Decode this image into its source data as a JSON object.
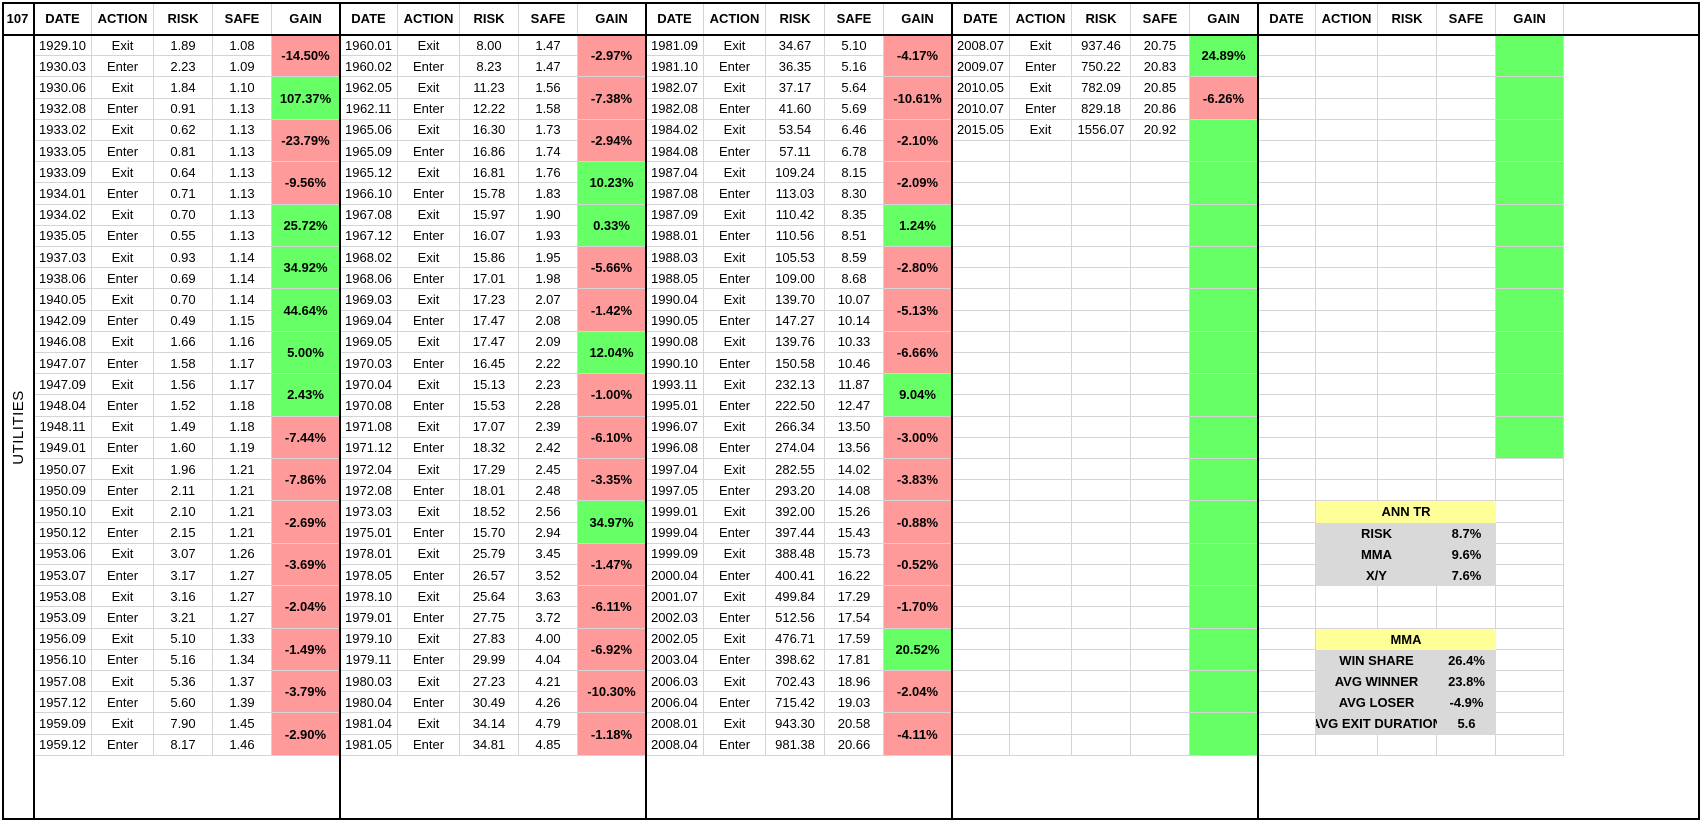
{
  "corner_label": "107",
  "side_label": "UTILITIES",
  "headers": [
    "DATE",
    "ACTION",
    "RISK",
    "SAFE",
    "GAIN"
  ],
  "colors": {
    "loss": "#ff9a9a",
    "win": "#66ff66",
    "stat_title": "#ffff99",
    "stat_row": "#d9d9d9"
  },
  "blocks": [
    {
      "rows": [
        [
          "1929.10",
          "Exit",
          "1.89",
          "1.08"
        ],
        [
          "1930.03",
          "Enter",
          "2.23",
          "1.09"
        ],
        [
          "1930.06",
          "Exit",
          "1.84",
          "1.10"
        ],
        [
          "1932.08",
          "Enter",
          "0.91",
          "1.13"
        ],
        [
          "1933.02",
          "Exit",
          "0.62",
          "1.13"
        ],
        [
          "1933.05",
          "Enter",
          "0.81",
          "1.13"
        ],
        [
          "1933.09",
          "Exit",
          "0.64",
          "1.13"
        ],
        [
          "1934.01",
          "Enter",
          "0.71",
          "1.13"
        ],
        [
          "1934.02",
          "Exit",
          "0.70",
          "1.13"
        ],
        [
          "1935.05",
          "Enter",
          "0.55",
          "1.13"
        ],
        [
          "1937.03",
          "Exit",
          "0.93",
          "1.14"
        ],
        [
          "1938.06",
          "Enter",
          "0.69",
          "1.14"
        ],
        [
          "1940.05",
          "Exit",
          "0.70",
          "1.14"
        ],
        [
          "1942.09",
          "Enter",
          "0.49",
          "1.15"
        ],
        [
          "1946.08",
          "Exit",
          "1.66",
          "1.16"
        ],
        [
          "1947.07",
          "Enter",
          "1.58",
          "1.17"
        ],
        [
          "1947.09",
          "Exit",
          "1.56",
          "1.17"
        ],
        [
          "1948.04",
          "Enter",
          "1.52",
          "1.18"
        ],
        [
          "1948.11",
          "Exit",
          "1.49",
          "1.18"
        ],
        [
          "1949.01",
          "Enter",
          "1.60",
          "1.19"
        ],
        [
          "1950.07",
          "Exit",
          "1.96",
          "1.21"
        ],
        [
          "1950.09",
          "Enter",
          "2.11",
          "1.21"
        ],
        [
          "1950.10",
          "Exit",
          "2.10",
          "1.21"
        ],
        [
          "1950.12",
          "Enter",
          "2.15",
          "1.21"
        ],
        [
          "1953.06",
          "Exit",
          "3.07",
          "1.26"
        ],
        [
          "1953.07",
          "Enter",
          "3.17",
          "1.27"
        ],
        [
          "1953.08",
          "Exit",
          "3.16",
          "1.27"
        ],
        [
          "1953.09",
          "Enter",
          "3.21",
          "1.27"
        ],
        [
          "1956.09",
          "Exit",
          "5.10",
          "1.33"
        ],
        [
          "1956.10",
          "Enter",
          "5.16",
          "1.34"
        ],
        [
          "1957.08",
          "Exit",
          "5.36",
          "1.37"
        ],
        [
          "1957.12",
          "Enter",
          "5.60",
          "1.39"
        ],
        [
          "1959.09",
          "Exit",
          "7.90",
          "1.45"
        ],
        [
          "1959.12",
          "Enter",
          "8.17",
          "1.46"
        ]
      ],
      "gains": [
        {
          "v": "-14.50%",
          "c": "loss"
        },
        {
          "v": "107.37%",
          "c": "win"
        },
        {
          "v": "-23.79%",
          "c": "loss"
        },
        {
          "v": "-9.56%",
          "c": "loss"
        },
        {
          "v": "25.72%",
          "c": "win"
        },
        {
          "v": "34.92%",
          "c": "win"
        },
        {
          "v": "44.64%",
          "c": "win"
        },
        {
          "v": "5.00%",
          "c": "win"
        },
        {
          "v": "2.43%",
          "c": "win"
        },
        {
          "v": "-7.44%",
          "c": "loss"
        },
        {
          "v": "-7.86%",
          "c": "loss"
        },
        {
          "v": "-2.69%",
          "c": "loss"
        },
        {
          "v": "-3.69%",
          "c": "loss"
        },
        {
          "v": "-2.04%",
          "c": "loss"
        },
        {
          "v": "-1.49%",
          "c": "loss"
        },
        {
          "v": "-3.79%",
          "c": "loss"
        },
        {
          "v": "-2.90%",
          "c": "loss"
        }
      ]
    },
    {
      "rows": [
        [
          "1960.01",
          "Exit",
          "8.00",
          "1.47"
        ],
        [
          "1960.02",
          "Enter",
          "8.23",
          "1.47"
        ],
        [
          "1962.05",
          "Exit",
          "11.23",
          "1.56"
        ],
        [
          "1962.11",
          "Enter",
          "12.22",
          "1.58"
        ],
        [
          "1965.06",
          "Exit",
          "16.30",
          "1.73"
        ],
        [
          "1965.09",
          "Enter",
          "16.86",
          "1.74"
        ],
        [
          "1965.12",
          "Exit",
          "16.81",
          "1.76"
        ],
        [
          "1966.10",
          "Enter",
          "15.78",
          "1.83"
        ],
        [
          "1967.08",
          "Exit",
          "15.97",
          "1.90"
        ],
        [
          "1967.12",
          "Enter",
          "16.07",
          "1.93"
        ],
        [
          "1968.02",
          "Exit",
          "15.86",
          "1.95"
        ],
        [
          "1968.06",
          "Enter",
          "17.01",
          "1.98"
        ],
        [
          "1969.03",
          "Exit",
          "17.23",
          "2.07"
        ],
        [
          "1969.04",
          "Enter",
          "17.47",
          "2.08"
        ],
        [
          "1969.05",
          "Exit",
          "17.47",
          "2.09"
        ],
        [
          "1970.03",
          "Enter",
          "16.45",
          "2.22"
        ],
        [
          "1970.04",
          "Exit",
          "15.13",
          "2.23"
        ],
        [
          "1970.08",
          "Enter",
          "15.53",
          "2.28"
        ],
        [
          "1971.08",
          "Exit",
          "17.07",
          "2.39"
        ],
        [
          "1971.12",
          "Enter",
          "18.32",
          "2.42"
        ],
        [
          "1972.04",
          "Exit",
          "17.29",
          "2.45"
        ],
        [
          "1972.08",
          "Enter",
          "18.01",
          "2.48"
        ],
        [
          "1973.03",
          "Exit",
          "18.52",
          "2.56"
        ],
        [
          "1975.01",
          "Enter",
          "15.70",
          "2.94"
        ],
        [
          "1978.01",
          "Exit",
          "25.79",
          "3.45"
        ],
        [
          "1978.05",
          "Enter",
          "26.57",
          "3.52"
        ],
        [
          "1978.10",
          "Exit",
          "25.64",
          "3.63"
        ],
        [
          "1979.01",
          "Enter",
          "27.75",
          "3.72"
        ],
        [
          "1979.10",
          "Exit",
          "27.83",
          "4.00"
        ],
        [
          "1979.11",
          "Enter",
          "29.99",
          "4.04"
        ],
        [
          "1980.03",
          "Exit",
          "27.23",
          "4.21"
        ],
        [
          "1980.04",
          "Enter",
          "30.49",
          "4.26"
        ],
        [
          "1981.04",
          "Exit",
          "34.14",
          "4.79"
        ],
        [
          "1981.05",
          "Enter",
          "34.81",
          "4.85"
        ]
      ],
      "gains": [
        {
          "v": "-2.97%",
          "c": "loss"
        },
        {
          "v": "-7.38%",
          "c": "loss"
        },
        {
          "v": "-2.94%",
          "c": "loss"
        },
        {
          "v": "10.23%",
          "c": "win"
        },
        {
          "v": "0.33%",
          "c": "win"
        },
        {
          "v": "-5.66%",
          "c": "loss"
        },
        {
          "v": "-1.42%",
          "c": "loss"
        },
        {
          "v": "12.04%",
          "c": "win"
        },
        {
          "v": "-1.00%",
          "c": "loss"
        },
        {
          "v": "-6.10%",
          "c": "loss"
        },
        {
          "v": "-3.35%",
          "c": "loss"
        },
        {
          "v": "34.97%",
          "c": "win"
        },
        {
          "v": "-1.47%",
          "c": "loss"
        },
        {
          "v": "-6.11%",
          "c": "loss"
        },
        {
          "v": "-6.92%",
          "c": "loss"
        },
        {
          "v": "-10.30%",
          "c": "loss"
        },
        {
          "v": "-1.18%",
          "c": "loss"
        }
      ]
    },
    {
      "rows": [
        [
          "1981.09",
          "Exit",
          "34.67",
          "5.10"
        ],
        [
          "1981.10",
          "Enter",
          "36.35",
          "5.16"
        ],
        [
          "1982.07",
          "Exit",
          "37.17",
          "5.64"
        ],
        [
          "1982.08",
          "Enter",
          "41.60",
          "5.69"
        ],
        [
          "1984.02",
          "Exit",
          "53.54",
          "6.46"
        ],
        [
          "1984.08",
          "Enter",
          "57.11",
          "6.78"
        ],
        [
          "1987.04",
          "Exit",
          "109.24",
          "8.15"
        ],
        [
          "1987.08",
          "Enter",
          "113.03",
          "8.30"
        ],
        [
          "1987.09",
          "Exit",
          "110.42",
          "8.35"
        ],
        [
          "1988.01",
          "Enter",
          "110.56",
          "8.51"
        ],
        [
          "1988.03",
          "Exit",
          "105.53",
          "8.59"
        ],
        [
          "1988.05",
          "Enter",
          "109.00",
          "8.68"
        ],
        [
          "1990.04",
          "Exit",
          "139.70",
          "10.07"
        ],
        [
          "1990.05",
          "Enter",
          "147.27",
          "10.14"
        ],
        [
          "1990.08",
          "Exit",
          "139.76",
          "10.33"
        ],
        [
          "1990.10",
          "Enter",
          "150.58",
          "10.46"
        ],
        [
          "1993.11",
          "Exit",
          "232.13",
          "11.87"
        ],
        [
          "1995.01",
          "Enter",
          "222.50",
          "12.47"
        ],
        [
          "1996.07",
          "Exit",
          "266.34",
          "13.50"
        ],
        [
          "1996.08",
          "Enter",
          "274.04",
          "13.56"
        ],
        [
          "1997.04",
          "Exit",
          "282.55",
          "14.02"
        ],
        [
          "1997.05",
          "Enter",
          "293.20",
          "14.08"
        ],
        [
          "1999.01",
          "Exit",
          "392.00",
          "15.26"
        ],
        [
          "1999.04",
          "Enter",
          "397.44",
          "15.43"
        ],
        [
          "1999.09",
          "Exit",
          "388.48",
          "15.73"
        ],
        [
          "2000.04",
          "Enter",
          "400.41",
          "16.22"
        ],
        [
          "2001.07",
          "Exit",
          "499.84",
          "17.29"
        ],
        [
          "2002.03",
          "Enter",
          "512.56",
          "17.54"
        ],
        [
          "2002.05",
          "Exit",
          "476.71",
          "17.59"
        ],
        [
          "2003.04",
          "Enter",
          "398.62",
          "17.81"
        ],
        [
          "2006.03",
          "Exit",
          "702.43",
          "18.96"
        ],
        [
          "2006.04",
          "Enter",
          "715.42",
          "19.03"
        ],
        [
          "2008.01",
          "Exit",
          "943.30",
          "20.58"
        ],
        [
          "2008.04",
          "Enter",
          "981.38",
          "20.66"
        ]
      ],
      "gains": [
        {
          "v": "-4.17%",
          "c": "loss"
        },
        {
          "v": "-10.61%",
          "c": "loss"
        },
        {
          "v": "-2.10%",
          "c": "loss"
        },
        {
          "v": "-2.09%",
          "c": "loss"
        },
        {
          "v": "1.24%",
          "c": "win"
        },
        {
          "v": "-2.80%",
          "c": "loss"
        },
        {
          "v": "-5.13%",
          "c": "loss"
        },
        {
          "v": "-6.66%",
          "c": "loss"
        },
        {
          "v": "9.04%",
          "c": "win"
        },
        {
          "v": "-3.00%",
          "c": "loss"
        },
        {
          "v": "-3.83%",
          "c": "loss"
        },
        {
          "v": "-0.88%",
          "c": "loss"
        },
        {
          "v": "-0.52%",
          "c": "loss"
        },
        {
          "v": "-1.70%",
          "c": "loss"
        },
        {
          "v": "20.52%",
          "c": "win"
        },
        {
          "v": "-2.04%",
          "c": "loss"
        },
        {
          "v": "-4.11%",
          "c": "loss"
        }
      ]
    },
    {
      "rows": [
        [
          "2008.07",
          "Exit",
          "937.46",
          "20.75"
        ],
        [
          "2009.07",
          "Enter",
          "750.22",
          "20.83"
        ],
        [
          "2010.05",
          "Exit",
          "782.09",
          "20.85"
        ],
        [
          "2010.07",
          "Enter",
          "829.18",
          "20.86"
        ],
        [
          "2015.05",
          "Exit",
          "1556.07",
          "20.92"
        ]
      ],
      "gains": [
        {
          "v": "24.89%",
          "c": "win"
        },
        {
          "v": "-6.26%",
          "c": "loss"
        },
        {
          "v": "",
          "c": "win"
        },
        {
          "v": "",
          "c": "win"
        },
        {
          "v": "",
          "c": "win"
        },
        {
          "v": "",
          "c": "win"
        },
        {
          "v": "",
          "c": "win"
        },
        {
          "v": "",
          "c": "win"
        },
        {
          "v": "",
          "c": "win"
        },
        {
          "v": "",
          "c": "win"
        },
        {
          "v": "",
          "c": "win"
        },
        {
          "v": "",
          "c": "win"
        },
        {
          "v": "",
          "c": "win"
        },
        {
          "v": "",
          "c": "win"
        },
        {
          "v": "",
          "c": "win"
        },
        {
          "v": "",
          "c": "win"
        },
        {
          "v": "",
          "c": "win"
        }
      ]
    },
    {
      "rows": [],
      "gains": [
        {
          "v": "",
          "c": "win"
        },
        {
          "v": "",
          "c": "win"
        },
        {
          "v": "",
          "c": "win"
        },
        {
          "v": "",
          "c": "win"
        },
        {
          "v": "",
          "c": "win"
        },
        {
          "v": "",
          "c": "win"
        },
        {
          "v": "",
          "c": "win"
        },
        {
          "v": "",
          "c": "win"
        },
        {
          "v": "",
          "c": "win"
        },
        {
          "v": "",
          "c": "win"
        }
      ]
    }
  ],
  "stats": {
    "ann_tr": {
      "title": "ANN TR",
      "rows": [
        {
          "label": "RISK",
          "value": "8.7%"
        },
        {
          "label": "MMA",
          "value": "9.6%"
        },
        {
          "label": "X/Y",
          "value": "7.6%"
        }
      ]
    },
    "mma": {
      "title": "MMA",
      "rows": [
        {
          "label": "WIN SHARE",
          "value": "26.4%"
        },
        {
          "label": "AVG WINNER",
          "value": "23.8%"
        },
        {
          "label": "AVG LOSER",
          "value": "-4.9%"
        },
        {
          "label": "AVG EXIT DURATION",
          "value": "5.6"
        }
      ]
    }
  }
}
